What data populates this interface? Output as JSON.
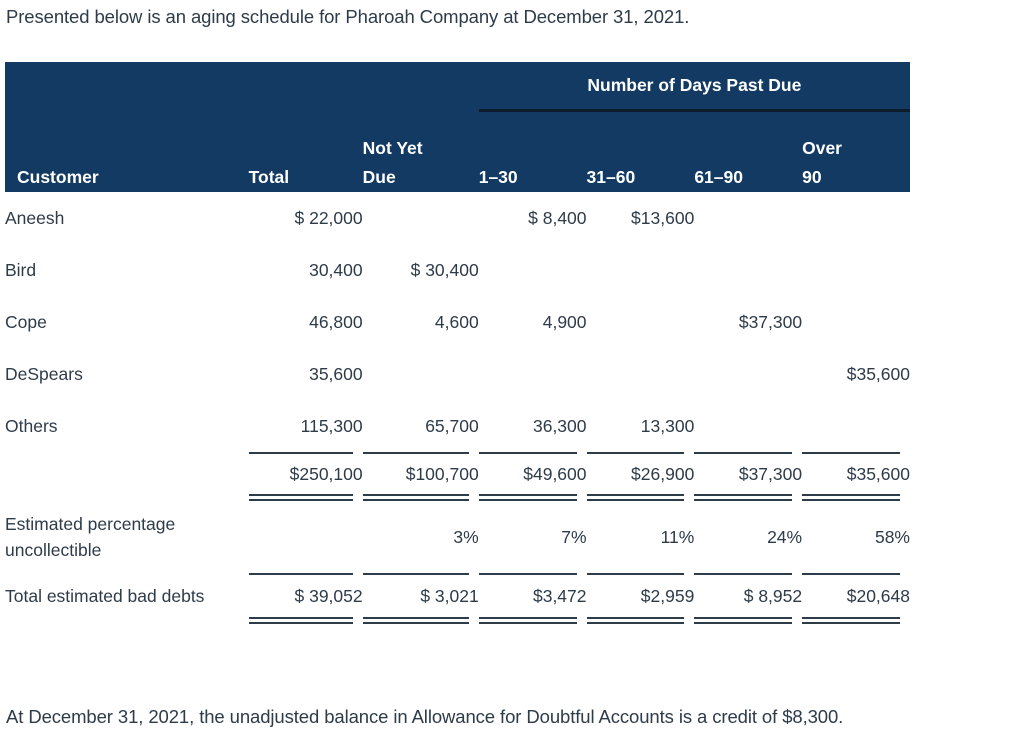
{
  "intro": "Presented below is an aging schedule for Pharoah Company at December 31, 2021.",
  "closing": "At December 31, 2021, the unadjusted balance in Allowance for Doubtful Accounts is a credit of $8,300.",
  "colors": {
    "header_background": "#123a63",
    "header_text": "#ffffff",
    "body_text": "#2e3b49",
    "rule": "#2e3b49",
    "page_background": "#ffffff"
  },
  "table": {
    "group_header": "Number of Days Past Due",
    "columns": [
      {
        "key": "customer",
        "label": "Customer"
      },
      {
        "key": "total",
        "label": "Total"
      },
      {
        "key": "not_yet_due",
        "label": "Not Yet\nDue"
      },
      {
        "key": "d1_30",
        "label": "1–30"
      },
      {
        "key": "d31_60",
        "label": "31–60"
      },
      {
        "key": "d61_90",
        "label": "61–90"
      },
      {
        "key": "over_90",
        "label": "Over\n90"
      }
    ],
    "rows": [
      {
        "customer": "Aneesh",
        "total": "$ 22,000",
        "not_yet_due": "",
        "d1_30": "$ 8,400",
        "d31_60": "$13,600",
        "d61_90": "",
        "over_90": ""
      },
      {
        "customer": "Bird",
        "total": "30,400",
        "not_yet_due": "$ 30,400",
        "d1_30": "",
        "d31_60": "",
        "d61_90": "",
        "over_90": ""
      },
      {
        "customer": "Cope",
        "total": "46,800",
        "not_yet_due": "4,600",
        "d1_30": "4,900",
        "d31_60": "",
        "d61_90": "$37,300",
        "over_90": ""
      },
      {
        "customer": "DeSpears",
        "total": "35,600",
        "not_yet_due": "",
        "d1_30": "",
        "d31_60": "",
        "d61_90": "",
        "over_90": "$35,600"
      },
      {
        "customer": "Others",
        "total": "115,300",
        "not_yet_due": "65,700",
        "d1_30": "36,300",
        "d31_60": "13,300",
        "d61_90": "",
        "over_90": ""
      }
    ],
    "totals_row": {
      "customer": "",
      "total": "$250,100",
      "not_yet_due": "$100,700",
      "d1_30": "$49,600",
      "d31_60": "$26,900",
      "d61_90": "$37,300",
      "over_90": "$35,600"
    },
    "percentage_row": {
      "customer": "Estimated percentage uncollectible",
      "total": "",
      "not_yet_due": "3%",
      "d1_30": "7%",
      "d31_60": "11%",
      "d61_90": "24%",
      "over_90": "58%"
    },
    "bad_debts_row": {
      "customer": "Total estimated bad debts",
      "total": "$ 39,052",
      "not_yet_due": "$ 3,021",
      "d1_30": "$3,472",
      "d31_60": "$2,959",
      "d61_90": "$ 8,952",
      "over_90": "$20,648"
    }
  }
}
